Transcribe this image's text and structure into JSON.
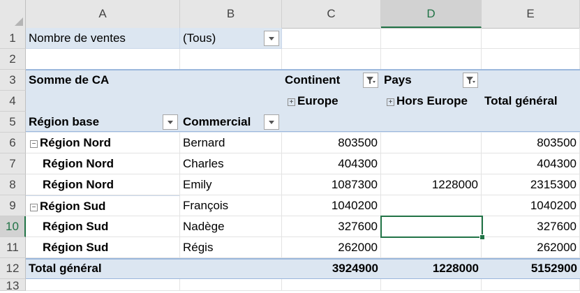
{
  "columns": [
    "A",
    "B",
    "C",
    "D",
    "E"
  ],
  "rows": [
    "1",
    "2",
    "3",
    "4",
    "5",
    "6",
    "7",
    "8",
    "9",
    "10",
    "11",
    "12",
    "13"
  ],
  "pivot": {
    "filter_label": "Nombre de ventes",
    "filter_value": "(Tous)",
    "values_label": "Somme de CA",
    "col_field_1": "Continent",
    "col_field_2": "Pays",
    "col_item_europe": "Europe",
    "col_item_hors_europe": "Hors Europe",
    "grand_total_col": "Total général",
    "row_field_1": "Région base",
    "row_field_2": "Commercial",
    "data_rows": [
      {
        "region": "Région Nord",
        "commercial": "Bernard",
        "europe": "803500",
        "hors": "",
        "total": "803500",
        "collapse": "⊟"
      },
      {
        "region": "Région Nord",
        "commercial": "Charles",
        "europe": "404300",
        "hors": "",
        "total": "404300",
        "collapse": ""
      },
      {
        "region": "Région Nord",
        "commercial": "Emily",
        "europe": "1087300",
        "hors": "1228000",
        "total": "2315300",
        "collapse": ""
      },
      {
        "region": "Région Sud",
        "commercial": "François",
        "europe": "1040200",
        "hors": "",
        "total": "1040200",
        "collapse": "⊟"
      },
      {
        "region": "Région Sud",
        "commercial": "Nadège",
        "europe": "327600",
        "hors": "",
        "total": "327600",
        "collapse": ""
      },
      {
        "region": "Région Sud",
        "commercial": "Régis",
        "europe": "262000",
        "hors": "",
        "total": "262000",
        "collapse": ""
      }
    ],
    "grand_total_row": {
      "label": "Total général",
      "europe": "3924900",
      "hors": "1228000",
      "total": "5152900"
    }
  },
  "colors": {
    "pivot_band": "#dce6f1",
    "selection": "#217346"
  }
}
